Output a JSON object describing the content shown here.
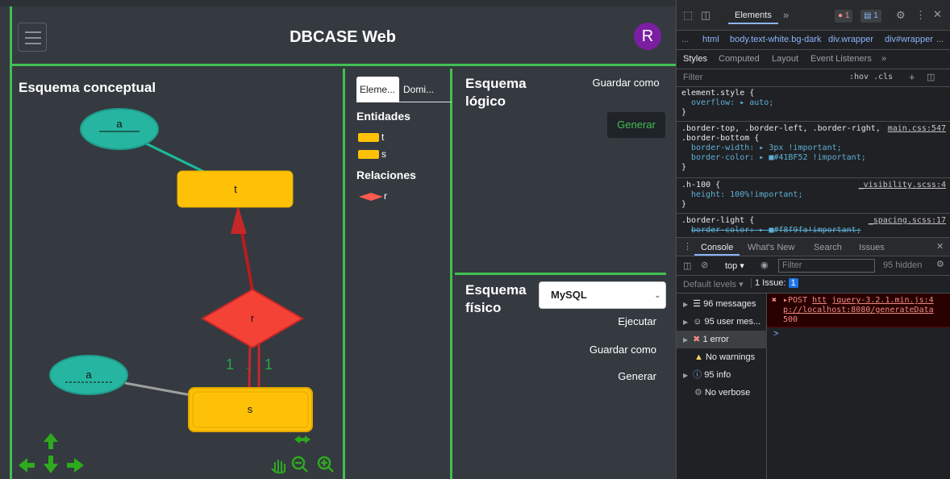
{
  "app": {
    "brand": "DBCASE Web",
    "avatar_letter": "R",
    "accent_color": "#41BF52",
    "conceptual": {
      "title": "Esquema conceptual",
      "diagram": {
        "entities": [
          "t",
          "s"
        ],
        "attributes": [
          "a",
          "a"
        ],
        "relation": "r",
        "cardinalities": [
          "1",
          "..",
          "1"
        ]
      },
      "controls": [
        "arrow-up-icon",
        "arrow-left-icon",
        "arrow-down-icon",
        "arrow-right-icon",
        "horizontal-resize-icon",
        "hand-pointer-icon",
        "zoom-out-icon",
        "zoom-in-icon"
      ]
    },
    "elements_panel": {
      "tabs": [
        "Eleme...",
        "Domi..."
      ],
      "entities_title": "Entidades",
      "entities": [
        "t",
        "s"
      ],
      "relations_title": "Relaciones",
      "relations": [
        "r"
      ]
    },
    "logico": {
      "title": "Esquema lógico",
      "save_label": "Guardar como",
      "generate_label": "Generar"
    },
    "fisico": {
      "title": "Esquema físico",
      "db_selected": "MySQL",
      "execute_label": "Ejecutar",
      "save_label": "Guardar como",
      "generate_label": "Generar"
    }
  },
  "devtools": {
    "main_tab": "Elements",
    "more": "»",
    "error_count": "1",
    "issue_count": "1",
    "breadcrumbs": [
      "...",
      "html",
      "body.text-white.bg-dark",
      "div.wrapper",
      "div#wrapper",
      "..."
    ],
    "subtabs": [
      "Styles",
      "Computed",
      "Layout",
      "Event Listeners",
      "»"
    ],
    "filter_placeholder": "Filter",
    "filter_tools": ":hov  .cls",
    "styles": {
      "r1_sel": "element.style {",
      "r1_prop": "overflow: ▸ auto;",
      "r2_sel_a": ".border-top, .border-left, .border-right,",
      "r2_sel_b": ".border-bottom {",
      "r2_src": "main.css:547",
      "r2_prop1": "border-width: ▸ 3px !important;",
      "r2_prop2": "border-color: ▸ ■#41BF52 !important;",
      "r3_sel": ".h-100 {",
      "r3_src": "_visibility.scss:4",
      "r3_prop": "height: 100%!important;",
      "r4_sel": ".border-light {",
      "r4_src": "_spacing.scss:17",
      "r4_prop": "border-color: ▸ ■#f8f9fa!important;",
      "close": "}"
    },
    "console": {
      "tabs": [
        "Console",
        "What's New",
        "Search",
        "Issues"
      ],
      "context": "top ▾",
      "filter_placeholder": "Filter",
      "hidden": "95 hidden",
      "levels": "Default levels ▾",
      "issue_label": "1 Issue:",
      "issue_count": "1",
      "sidebar": [
        {
          "label": "96 messages",
          "icon": "list-icon"
        },
        {
          "label": "95 user mes...",
          "icon": "user-icon"
        },
        {
          "label": "1 error",
          "icon": "error-icon"
        },
        {
          "label": "No warnings",
          "icon": "warning-icon"
        },
        {
          "label": "95 info",
          "icon": "info-icon"
        },
        {
          "label": "No verbose",
          "icon": "bug-icon"
        }
      ],
      "error_line1_a": "▸POST ",
      "error_line1_link1": "htt",
      "error_line1_link2": "jquery-3.2.1.min.js:4",
      "error_line2": "p://localhost:8080/generateData",
      "error_line3": "500",
      "prompt": ">"
    }
  }
}
